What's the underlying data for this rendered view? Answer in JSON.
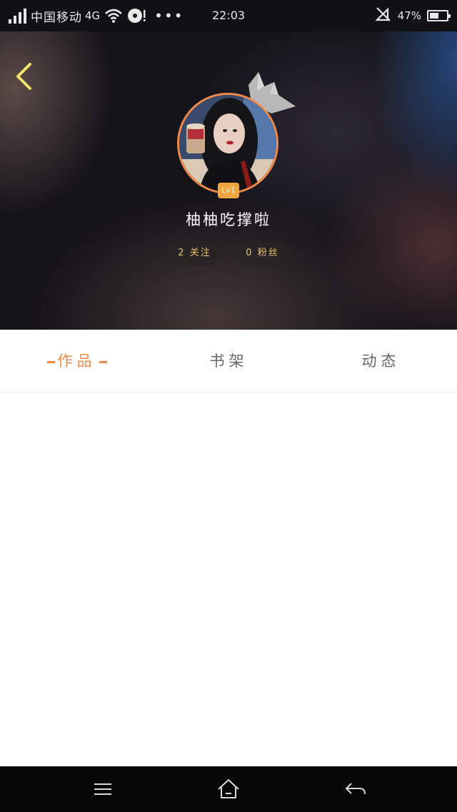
{
  "status_bar": {
    "carrier": "中国移动",
    "network": "4G",
    "more": "•••",
    "time": "22:03",
    "battery_percent": "47%",
    "battery_level": 0.47,
    "icons": [
      "signal-icon",
      "wifi-icon",
      "media-icon",
      "mute-icon",
      "battery-icon"
    ]
  },
  "profile": {
    "back_icon": "chevron-left-icon",
    "crown_icon": "crown-icon",
    "level": "Lv1",
    "username": "柚柚吃撑啦",
    "following_label": "2 关注",
    "fans_label": "0 粉丝",
    "accent_color": "#ef8a4c",
    "stat_text_color": "#e8c16a"
  },
  "tabs": {
    "works": "作品",
    "bookshelf": "书架",
    "dynamics": "动态",
    "active": "works"
  },
  "nav_bar": {
    "icons": [
      "menu-icon",
      "home-icon",
      "back-arrow-icon"
    ]
  }
}
